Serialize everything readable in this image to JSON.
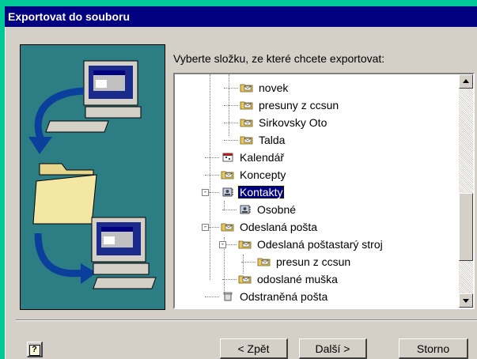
{
  "dialog": {
    "title": "Exportovat do souboru",
    "prompt": "Vyberte složku, ze které chcete exportovat:"
  },
  "tree": {
    "items": [
      {
        "label": "novek",
        "icon": "folder-letter-icon",
        "selected": false
      },
      {
        "label": "presuny z ccsun",
        "icon": "folder-letter-icon",
        "selected": false
      },
      {
        "label": "Sirkovsky Oto",
        "icon": "folder-letter-icon",
        "selected": false
      },
      {
        "label": "Talda",
        "icon": "folder-letter-icon",
        "selected": false
      },
      {
        "label": "Kalendář",
        "icon": "calendar-icon",
        "selected": false
      },
      {
        "label": "Koncepty",
        "icon": "folder-letter-icon",
        "selected": false
      },
      {
        "label": "Kontakty",
        "icon": "contacts-icon",
        "selected": true
      },
      {
        "label": "Osobné",
        "icon": "contacts-icon",
        "selected": false
      },
      {
        "label": "Odeslaná pošta",
        "icon": "folder-letter-icon",
        "selected": false
      },
      {
        "label": "Odeslaná poštastarý stroj",
        "icon": "folder-letter-icon",
        "selected": false
      },
      {
        "label": "presun z ccsun",
        "icon": "folder-letter-icon",
        "selected": false
      },
      {
        "label": "odoslané muška",
        "icon": "folder-letter-icon",
        "selected": false
      },
      {
        "label": "Odstraněná pošta",
        "icon": "trash-icon",
        "selected": false
      }
    ]
  },
  "buttons": {
    "back": "< Zpět",
    "next": "Další >",
    "cancel": "Storno",
    "help": "?"
  },
  "colors": {
    "titlebar": "#000080",
    "desktop": "#00c896",
    "panel": "#2d7d84",
    "selection": "#000080"
  }
}
